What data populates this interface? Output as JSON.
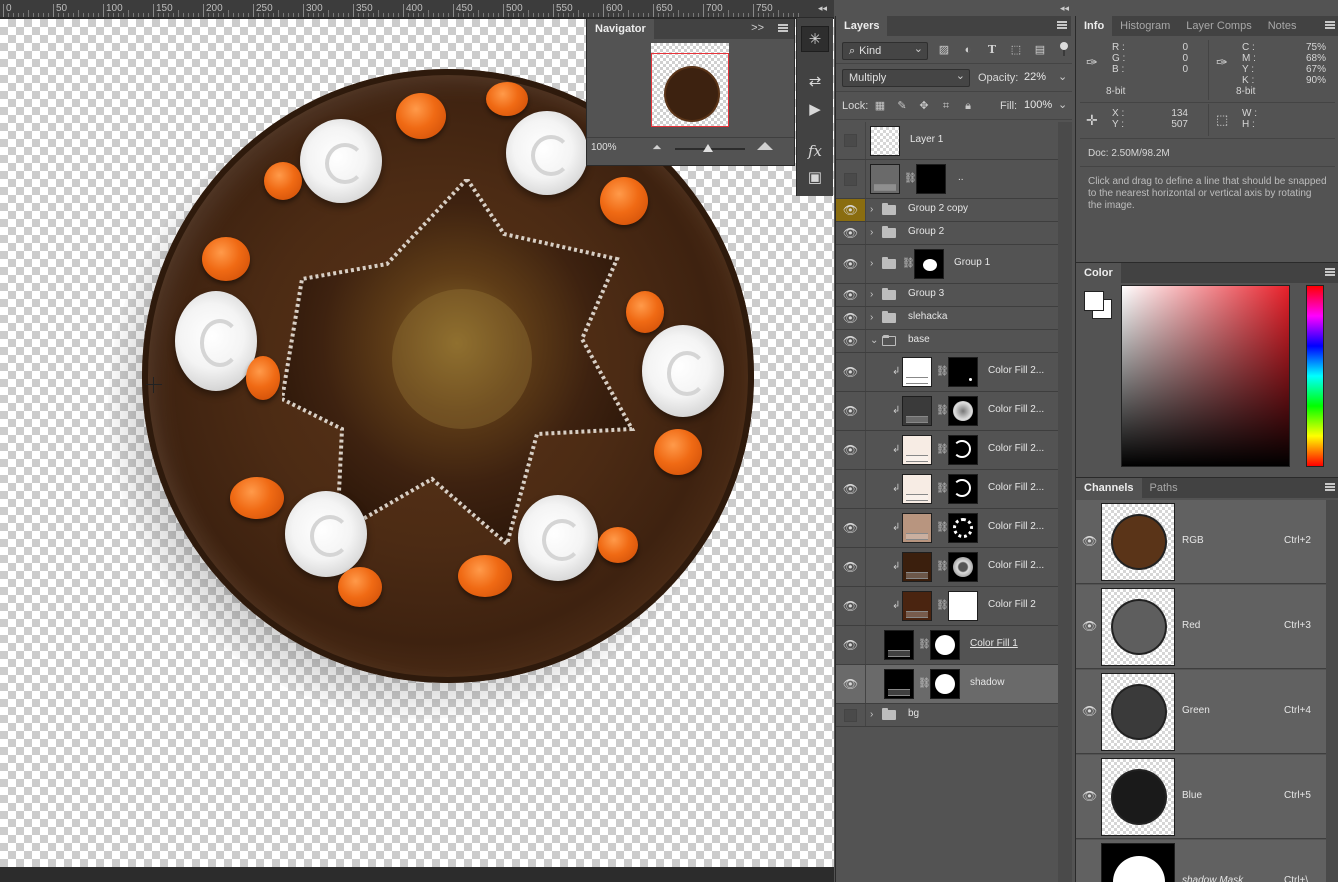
{
  "ruler": {
    "labels": [
      "0",
      "50",
      "100",
      "150",
      "200",
      "250",
      "300",
      "350",
      "400",
      "450",
      "500",
      "550",
      "600",
      "650",
      "700",
      "750"
    ],
    "collapse": "◂◂"
  },
  "navigator": {
    "tabs": [
      "Navigator"
    ],
    "collapse": ">>",
    "zoom": "100%"
  },
  "tool_strip": {
    "icons": [
      "compass-icon",
      "history-icon",
      "play-icon",
      "fx-icon",
      "cube-icon"
    ]
  },
  "layers": {
    "tab": "Layers",
    "collapse": "◂◂",
    "filter_kind": "Kind",
    "blend_mode": "Multiply",
    "opacity_label": "Opacity:",
    "opacity_value": "22%",
    "lock_label": "Lock:",
    "fill_label": "Fill:",
    "fill_value": "100%",
    "rows": [
      {
        "name": "Layer 1",
        "visible": false,
        "kind": "pixel"
      },
      {
        "name": "..",
        "visible": false,
        "kind": "pixel-mask"
      },
      {
        "name": "Group 2 copy",
        "visible": true,
        "kind": "group",
        "highlight": true
      },
      {
        "name": "Group 2",
        "visible": true,
        "kind": "group"
      },
      {
        "name": "Group 1",
        "visible": true,
        "kind": "group-mask"
      },
      {
        "name": "Group 3",
        "visible": true,
        "kind": "group"
      },
      {
        "name": "slehacka",
        "visible": true,
        "kind": "group"
      },
      {
        "name": "base",
        "visible": true,
        "kind": "group-open"
      },
      {
        "name": "Color Fill 2...",
        "visible": true,
        "kind": "fill",
        "color": "#ffffff",
        "mask": "ring-small"
      },
      {
        "name": "Color Fill 2...",
        "visible": true,
        "kind": "fill",
        "color": "#3a3a3a",
        "mask": "textured"
      },
      {
        "name": "Color Fill 2...",
        "visible": true,
        "kind": "fill",
        "color": "#f7ece4",
        "mask": "ring"
      },
      {
        "name": "Color Fill 2...",
        "visible": true,
        "kind": "fill",
        "color": "#f7ece4",
        "mask": "ring"
      },
      {
        "name": "Color Fill 2...",
        "visible": true,
        "kind": "fill",
        "color": "#b8957f",
        "mask": "ring-star"
      },
      {
        "name": "Color Fill 2...",
        "visible": true,
        "kind": "fill",
        "color": "#3b1f0d",
        "mask": "star"
      },
      {
        "name": "Color Fill 2",
        "visible": true,
        "kind": "fill",
        "color": "#4a2410",
        "mask": "white"
      },
      {
        "name": "Color Fill 1",
        "visible": true,
        "kind": "fill-root",
        "color": "#000000",
        "mask": "disc"
      },
      {
        "name": "shadow",
        "visible": true,
        "kind": "fill-root",
        "color": "#000000",
        "mask": "disc",
        "selected": true
      },
      {
        "name": "bg",
        "visible": false,
        "kind": "group"
      }
    ]
  },
  "info": {
    "tabs": [
      "Info",
      "Histogram",
      "Layer Comps",
      "Notes"
    ],
    "rgb_labels": [
      "R :",
      "G :",
      "B :"
    ],
    "rgb_values": [
      "0",
      "0",
      "0"
    ],
    "cmyk_labels": [
      "C :",
      "M :",
      "Y :",
      "K :"
    ],
    "cmyk_values": [
      "75%",
      "68%",
      "67%",
      "90%"
    ],
    "bit_left": "8-bit",
    "bit_right": "8-bit",
    "xy_labels": [
      "X :",
      "Y :"
    ],
    "xy_values": [
      "134",
      "507"
    ],
    "wh_labels": [
      "W :",
      "H :"
    ],
    "doc": "Doc: 2.50M/98.2M",
    "hint": "Click and drag to define a line that should be snapped to the nearest horizontal or vertical axis by rotating the image."
  },
  "color": {
    "tab": "Color",
    "foreground": "#ffffff",
    "background": "#ffffff"
  },
  "channels": {
    "tabs": [
      "Channels",
      "Paths"
    ],
    "rows": [
      {
        "name": "RGB",
        "shortcut": "Ctrl+2",
        "disc": "#5a3418"
      },
      {
        "name": "Red",
        "shortcut": "Ctrl+3",
        "disc": "#5e5e5e"
      },
      {
        "name": "Green",
        "shortcut": "Ctrl+4",
        "disc": "#3a3a3a"
      },
      {
        "name": "Blue",
        "shortcut": "Ctrl+5",
        "disc": "#1a1a1a"
      },
      {
        "name": "shadow Mask",
        "shortcut": "Ctrl+\\",
        "disc": "#ffffff"
      }
    ]
  }
}
